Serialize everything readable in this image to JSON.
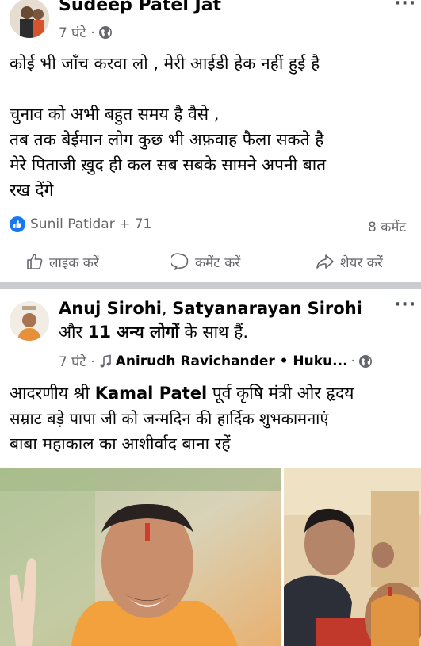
{
  "post1": {
    "author": "Sudeep Patel Jat",
    "time": "7 घंटे ·",
    "lines": [
      "कोई भी जाँच करवा लो , मेरी आईडी हेक नहीं हुई है",
      "चुनाव को अभी बहुत समय है वैसे ,",
      "तब तक बेईमान लोग कुछ भी अफ़वाह फैला सकते है",
      "मेरे पिताजी ख़ुद ही कल सब सबके सामने अपनी बात",
      "रख देंगे"
    ],
    "reactions": "Sunil Patidar + 71",
    "comments": "8 कमेंट",
    "actions": {
      "like": "लाइक करें",
      "comment": "कमेंट करें",
      "share": "शेयर करें"
    }
  },
  "post2": {
    "author1": "Anuj Sirohi",
    "sep": ",",
    "author2": "Satyanarayan Sirohi",
    "with_prefix": "और",
    "with_count": "11 अन्य लोगों",
    "with_suffix": "के साथ हैं.",
    "time": "7 घंटे ·",
    "music": "Anirudh Ravichander • Huku...",
    "music_sep": "·",
    "text_prefix": "आदरणीय श्री",
    "text_name": "Kamal Patel",
    "text_rest1": "पूर्व कृषि मंत्री ओर हृदय",
    "line2": "सम्राट बड़े पापा जी को जन्मदिन की हार्दिक शुभकामनाएं",
    "line3": "बाबा महाकाल का आशीर्वाद बाना रहें"
  }
}
